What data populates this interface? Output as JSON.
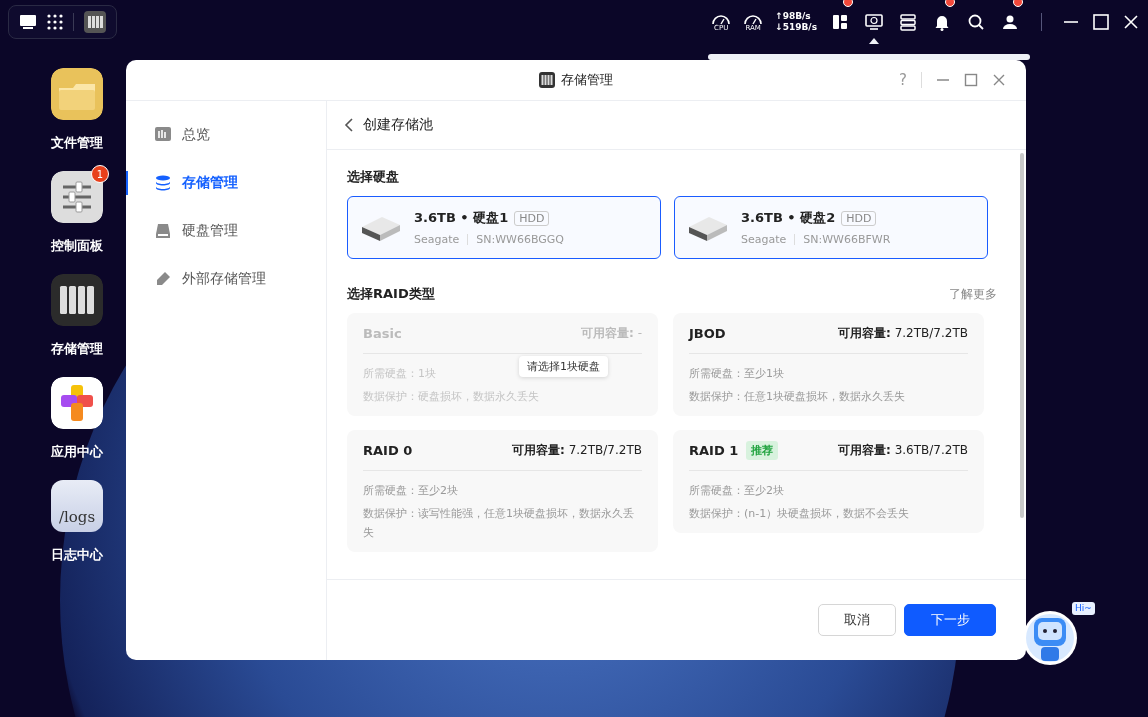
{
  "top_bar": {
    "monitors": [
      {
        "label": "CPU"
      },
      {
        "label": "RAM"
      }
    ],
    "upload": "↑98B/s",
    "download": "↓519B/s",
    "tray": [
      {
        "kind": "widgets",
        "badge": true,
        "selected": false
      },
      {
        "kind": "monitor",
        "badge": false,
        "selected": true
      },
      {
        "kind": "server",
        "badge": false,
        "selected": false
      },
      {
        "kind": "bell",
        "badge": true,
        "selected": false
      },
      {
        "kind": "search",
        "badge": false,
        "selected": false
      },
      {
        "kind": "user",
        "badge": true,
        "selected": false
      }
    ]
  },
  "desktop_icons": [
    {
      "kind": "folder",
      "label": "文件管理"
    },
    {
      "kind": "sliders",
      "label": "控制面板",
      "badge": "1"
    },
    {
      "kind": "storage",
      "label": "存储管理"
    },
    {
      "kind": "apps",
      "label": "应用中心"
    },
    {
      "kind": "logs",
      "label": "日志中心",
      "icon_text": "/logs"
    }
  ],
  "window": {
    "title": "存储管理",
    "help": "?"
  },
  "sidebar": {
    "items": [
      {
        "kind": "overview",
        "label": "总览",
        "selected": false
      },
      {
        "kind": "storage",
        "label": "存储管理",
        "selected": true
      },
      {
        "kind": "disk",
        "label": "硬盘管理",
        "selected": false
      },
      {
        "kind": "external",
        "label": "外部存储管理",
        "selected": false
      }
    ]
  },
  "page": {
    "title": "创建存储池",
    "disk_section": "选择硬盘",
    "disks": [
      {
        "size": "3.6TB • 硬盘1",
        "type": "HDD",
        "brand": "Seagate",
        "serial": "SN:WW66BGGQ",
        "selected": true
      },
      {
        "size": "3.6TB • 硬盘2",
        "type": "HDD",
        "brand": "Seagate",
        "serial": "SN:WW66BFWR",
        "selected": true
      }
    ],
    "raid_section": "选择RAID类型",
    "learn_more": "了解更多",
    "raid_options": [
      {
        "name": "Basic",
        "capacity_label": "可用容量:",
        "capacity": "-",
        "required": "所需硬盘：1块",
        "protection": "数据保护：硬盘损坏，数据永久丢失",
        "disabled": true,
        "tooltip": "请选择1块硬盘"
      },
      {
        "name": "JBOD",
        "capacity_label": "可用容量:",
        "capacity": "7.2TB/7.2TB",
        "required": "所需硬盘：至少1块",
        "protection": "数据保护：任意1块硬盘损坏，数据永久丢失",
        "disabled": false
      },
      {
        "name": "RAID 0",
        "capacity_label": "可用容量:",
        "capacity": "7.2TB/7.2TB",
        "required": "所需硬盘：至少2块",
        "protection": "数据保护：读写性能强，任意1块硬盘损坏，数据永久丢失",
        "disabled": false
      },
      {
        "name": "RAID 1",
        "badge": "推荐",
        "capacity_label": "可用容量:",
        "capacity": "3.6TB/7.2TB",
        "required": "所需硬盘：至少2块",
        "protection": "数据保护：(n-1）块硬盘损坏，数据不会丢失",
        "disabled": false
      }
    ]
  },
  "buttons": [
    {
      "kind": "secondary",
      "label": "取消"
    },
    {
      "kind": "primary",
      "label": "下一步"
    }
  ],
  "assistant": {
    "greeting": "Hi~"
  }
}
